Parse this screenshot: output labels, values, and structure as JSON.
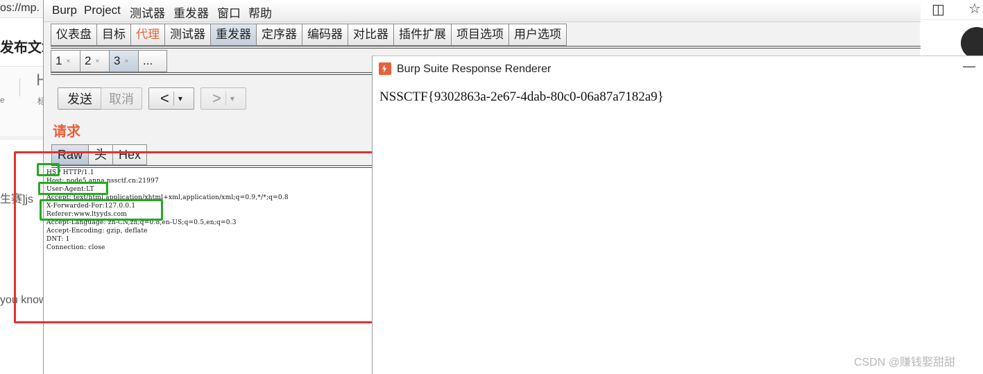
{
  "background_browser": {
    "url_fragment": "os://mp.",
    "page_title_fragment": "发布文章",
    "h_fragment": "H",
    "small_left": "e",
    "small_right": "标",
    "text1_fragment": "生赛]js",
    "text2_fragment": "you know"
  },
  "burp": {
    "menu": [
      "Burp",
      "Project",
      "测试器",
      "重发器",
      "窗口",
      "帮助"
    ],
    "tabs": [
      "仪表盘",
      "目标",
      "代理",
      "测试器",
      "重发器",
      "定序器",
      "编码器",
      "对比器",
      "插件扩展",
      "项目选项",
      "用户选项"
    ],
    "active_tab": "重发器",
    "sub_tabs": [
      {
        "label": "1",
        "close": "×"
      },
      {
        "label": "2",
        "close": "×"
      },
      {
        "label": "3",
        "close": "×"
      },
      {
        "label": "...",
        "close": ""
      }
    ],
    "buttons": {
      "send": "发送",
      "cancel": "取消",
      "prev": "<",
      "next": ">",
      "dropdown": "▾"
    },
    "request_label": "请求",
    "view_tabs": [
      "Raw",
      "头",
      "Hex"
    ],
    "request_lines": [
      "HS / HTTP/1.1",
      "Host: node5.anna.nssctf.cn:21997",
      "User-Agent:LT",
      "Accept: text/html,application/xhtml+xml,application/xml;q=0.9,*/*;q=0.8",
      "X-Forwarded-For:127.0.0.1",
      "Referer:www.ltyyds.com",
      "Accept-Language: zh-CN,zh;q=0.8,en-US;q=0.5,en;q=0.3",
      "Accept-Encoding: gzip, deflate",
      "DNT: 1",
      "Connection: close"
    ]
  },
  "renderer": {
    "title": "Burp Suite Response Renderer",
    "minimize": "—",
    "body": "NSSCTF{9302863a-2e67-4dab-80c0-06a87a7182a9}"
  },
  "watermark": "CSDN @赚钱娶甜甜",
  "colors": {
    "accent": "#e8613a",
    "annotation_red": "#e8302a",
    "annotation_green": "#22aa22"
  }
}
